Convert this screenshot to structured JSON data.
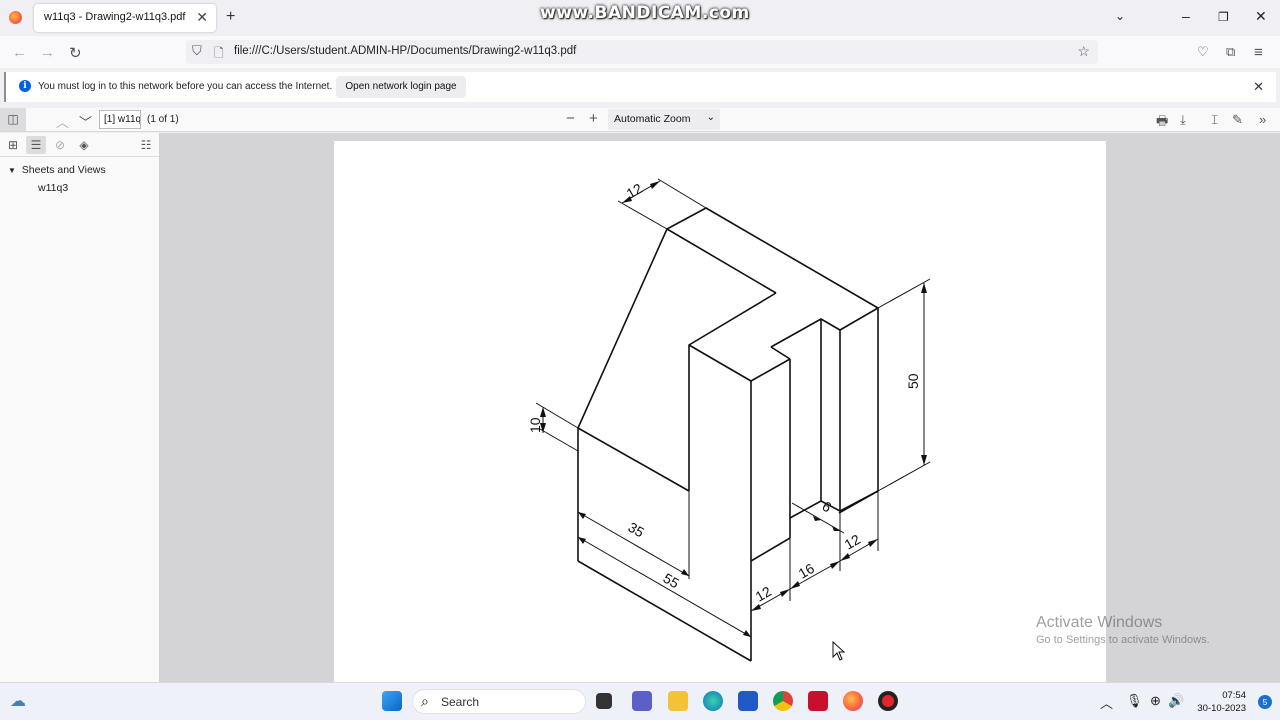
{
  "browser": {
    "tab_title": "w11q3 - Drawing2-w11q3.pdf",
    "url": "file:///C:/Users/student.ADMIN-HP/Documents/Drawing2-w11q3.pdf",
    "watermark": "www.BANDICAM.com"
  },
  "notification": {
    "message": "You must log in to this network before you can access the Internet.",
    "button": "Open network login page"
  },
  "pdf_toolbar": {
    "page_input": "[1] w11q3",
    "page_of": "(1 of 1)",
    "zoom": "Automatic Zoom"
  },
  "sidebar": {
    "root_label": "Sheets and Views",
    "child_label": "w11q3"
  },
  "drawing": {
    "dimensions": [
      "12",
      "50",
      "10",
      "35",
      "55",
      "6",
      "12",
      "16",
      "12"
    ]
  },
  "overlay": {
    "activate_title": "Activate Windows",
    "activate_sub": "Go to Settings to activate Windows."
  },
  "taskbar": {
    "search_label": "Search",
    "time": "07:54",
    "date": "30-10-2023",
    "notification_count": "5"
  }
}
